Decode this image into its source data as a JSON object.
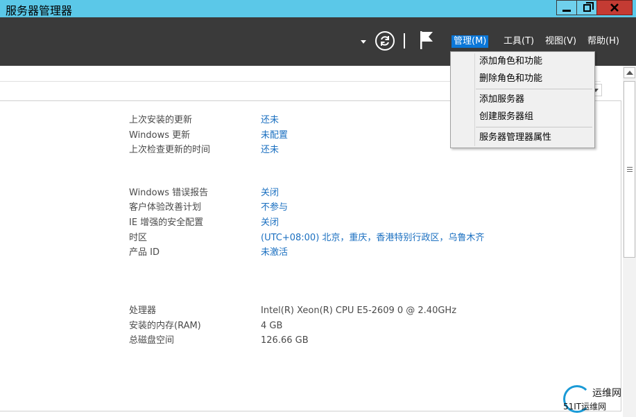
{
  "window": {
    "title": "服务器管理器"
  },
  "toolbar": {
    "menus": [
      {
        "label": "管理(M)",
        "active": true
      },
      {
        "label": "工具(T)"
      },
      {
        "label": "视图(V)"
      },
      {
        "label": "帮助(H)"
      }
    ]
  },
  "manage_menu": {
    "items": [
      "添加角色和功能",
      "删除角色和功能",
      "添加服务器",
      "创建服务器组",
      "服务器管理器属性"
    ]
  },
  "properties": {
    "updates": [
      {
        "label": "上次安装的更新",
        "value": "还未"
      },
      {
        "label": "Windows 更新",
        "value": "未配置"
      },
      {
        "label": "上次检查更新的时间",
        "value": "还未"
      }
    ],
    "settings": [
      {
        "label": "Windows 错误报告",
        "value": "关闭"
      },
      {
        "label": "客户体验改善计划",
        "value": "不参与"
      },
      {
        "label": "IE 增强的安全配置",
        "value": "关闭"
      },
      {
        "label": "时区",
        "value": "(UTC+08:00) 北京，重庆，香港特别行政区，乌鲁木齐"
      },
      {
        "label": "产品 ID",
        "value": "未激活"
      }
    ],
    "hardware": [
      {
        "label": "处理器",
        "value": "Intel(R) Xeon(R) CPU E5-2609 0 @ 2.40GHz"
      },
      {
        "label": "安装的内存(RAM)",
        "value": "4 GB"
      },
      {
        "label": "总磁盘空间",
        "value": "126.66 GB"
      }
    ]
  },
  "watermark": {
    "line1": "运维网",
    "line2": "51IT运维网"
  },
  "colors": {
    "titlebar": "#5bc8e8",
    "toolbar": "#3a3a3a",
    "link": "#1a6fc0",
    "menu_active": "#0b77d8",
    "close_button": "#c43b33"
  }
}
